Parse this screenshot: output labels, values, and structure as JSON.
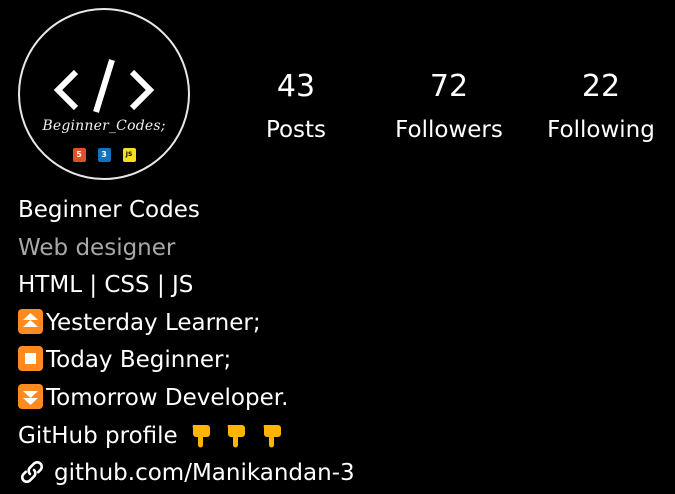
{
  "profile": {
    "avatar": {
      "logo_text": "Beginner_Codes;",
      "badges": [
        "5",
        "3",
        "JS"
      ]
    },
    "stats": [
      {
        "count": "43",
        "label": "Posts"
      },
      {
        "count": "72",
        "label": "Followers"
      },
      {
        "count": "22",
        "label": "Following"
      }
    ],
    "bio": {
      "name": "Beginner Codes",
      "category": "Web designer",
      "lines": [
        "HTML | CSS | JS",
        "Yesterday Learner;",
        "Today Beginner;",
        "Tomorrow Developer.",
        "GitHub profile"
      ],
      "line_icons": [
        "",
        "up-double-arrow-icon",
        "stop-icon",
        "down-double-arrow-icon",
        "pointing-down-hand-icon"
      ],
      "link": "github.com/Manikandan-3"
    }
  },
  "colors": {
    "background": "#000000",
    "text": "#ffffff",
    "category_text": "#a8a8a8",
    "emoji_orange": "#ff8a1f",
    "hand_yellow": "#ffb400"
  }
}
